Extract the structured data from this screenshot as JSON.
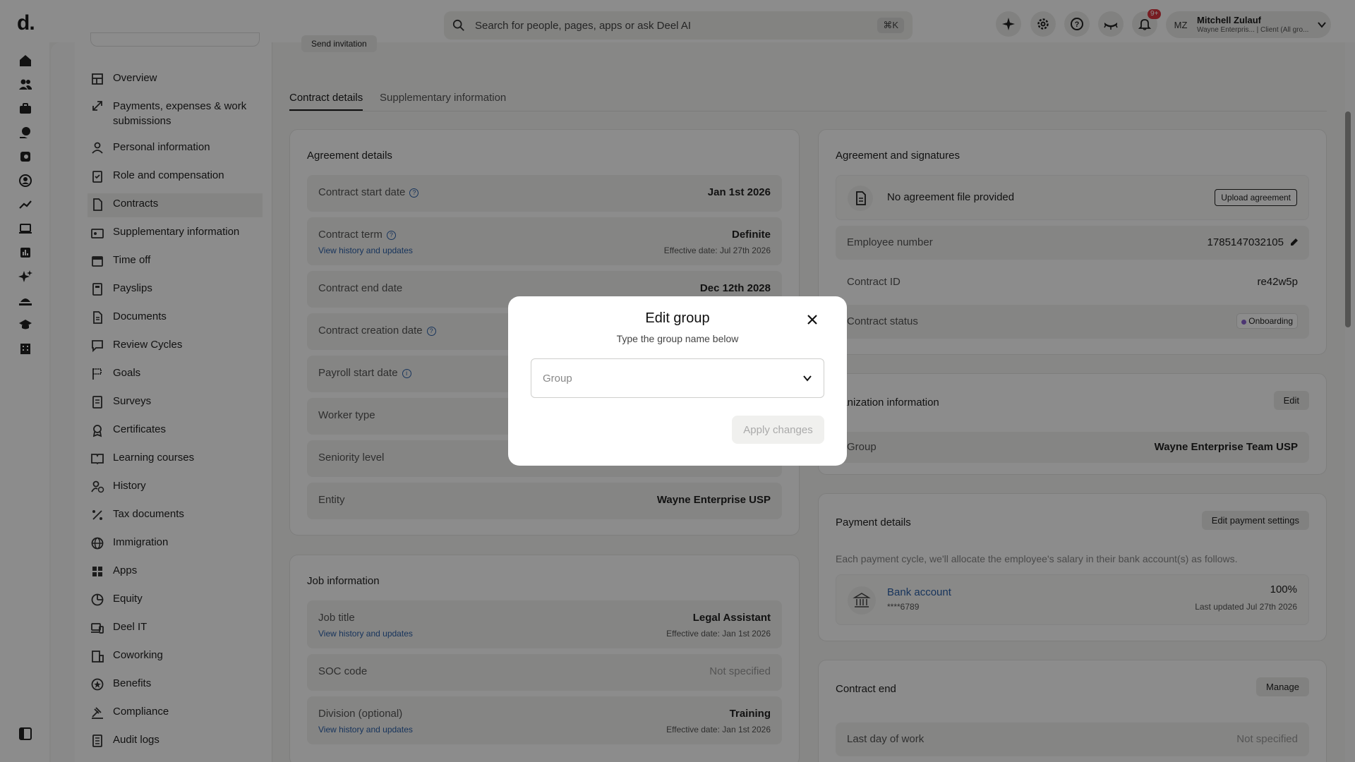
{
  "topbar": {
    "logo": "d.",
    "search_placeholder": "Search for people, pages, apps or ask Deel AI",
    "search_shortcut": "⌘K",
    "notifications_badge": "9+",
    "user_initials": "MZ",
    "user_name": "Mitchell Zulauf",
    "user_sub": "Wayne Enterpris... | Client (All gro..."
  },
  "subnav": {
    "items": [
      "Overview",
      "Payments, expenses & work submissions",
      "Personal information",
      "Role and compensation",
      "Contracts",
      "Supplementary information",
      "Time off",
      "Payslips",
      "Documents",
      "Review Cycles",
      "Goals",
      "Surveys",
      "Certificates",
      "Learning courses",
      "History",
      "Tax documents",
      "Immigration",
      "Apps",
      "Equity",
      "Deel IT",
      "Coworking",
      "Benefits",
      "Compliance",
      "Audit logs"
    ]
  },
  "header": {
    "send_invitation": "Send invitation"
  },
  "tabs": [
    "Contract details",
    "Supplementary information"
  ],
  "agreement_details": {
    "title": "Agreement details",
    "contract_start_label": "Contract start date",
    "contract_start_value": "Jan 1st 2026",
    "contract_term_label": "Contract term",
    "contract_term_value": "Definite",
    "contract_term_link": "View history and updates",
    "contract_term_effective": "Effective date: Jul 27th 2026",
    "contract_end_label": "Contract end date",
    "contract_end_value": "Dec 12th 2028",
    "creation_label": "Contract creation date",
    "payroll_label": "Payroll start date",
    "worker_type_label": "Worker type",
    "seniority_label": "Seniority level",
    "entity_label": "Entity",
    "entity_value": "Wayne Enterprise USP"
  },
  "job_information": {
    "title": "Job information",
    "job_title_label": "Job title",
    "job_title_value": "Legal Assistant",
    "job_title_link": "View history and updates",
    "job_title_effective": "Effective date: Jan 1st 2026",
    "soc_label": "SOC code",
    "soc_value": "Not specified",
    "division_label": "Division (optional)",
    "division_value": "Training",
    "division_link": "View history and updates",
    "division_effective": "Effective date: Jan 1st 2026"
  },
  "agreement_signatures": {
    "title": "Agreement and signatures",
    "no_file": "No agreement file provided",
    "upload": "Upload agreement",
    "employee_number_label": "Employee number",
    "employee_number_value": "1785147032105",
    "contract_id_label": "Contract ID",
    "contract_id_value": "re42w5p",
    "status_label": "Contract status",
    "status_value": "Onboarding"
  },
  "organization": {
    "title": "ganization information",
    "edit": "Edit",
    "group_label": "Group",
    "group_value": "Wayne Enterprise Team USP"
  },
  "payment": {
    "title": "Payment details",
    "edit": "Edit payment settings",
    "note": "Each payment cycle, we'll allocate the employee's salary in their bank account(s) as follows.",
    "bank_label": "Bank account",
    "bank_masked": "****6789",
    "percent": "100%",
    "updated": "Last updated Jul 27th 2026"
  },
  "contract_end": {
    "title": "Contract end",
    "manage": "Manage",
    "last_day_label": "Last day of work",
    "last_day_value": "Not specified"
  },
  "modal": {
    "title": "Edit group",
    "subtitle": "Type the group name below",
    "select_placeholder": "Group",
    "apply": "Apply changes"
  },
  "colors": {
    "accent_link": "#2b5fa8",
    "badge": "#d9363e",
    "status_dot": "#8a63d2"
  }
}
